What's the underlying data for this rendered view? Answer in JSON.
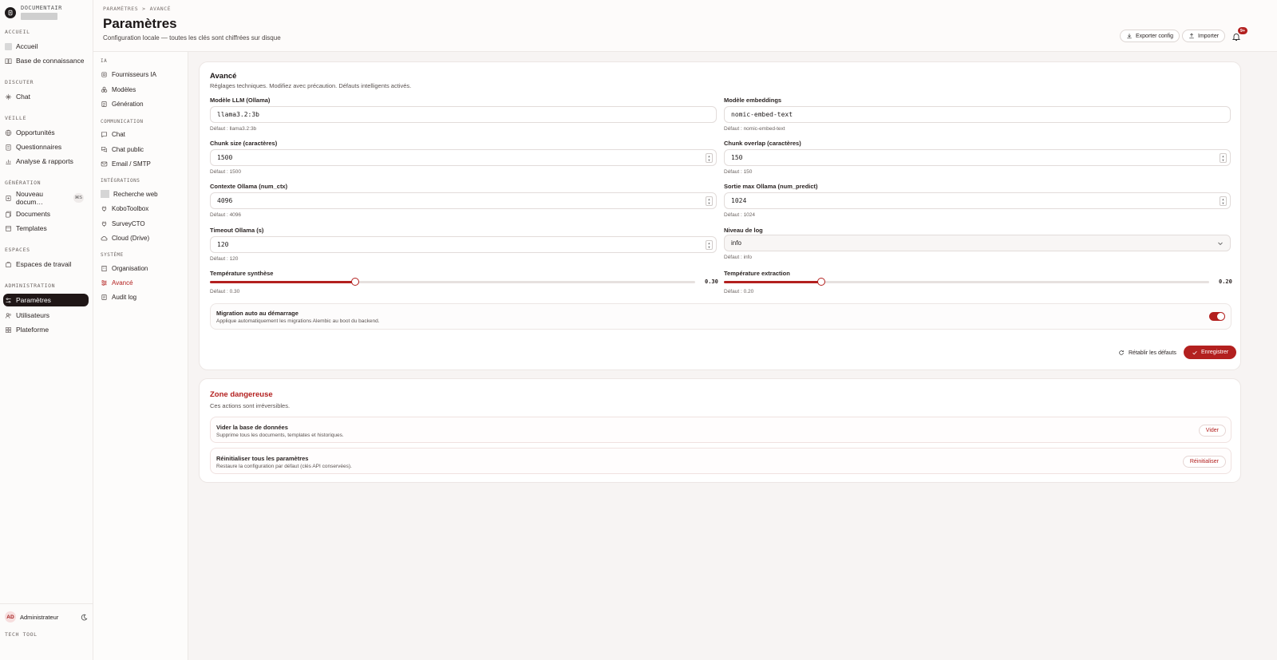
{
  "brand": {
    "name": "DOCUMENTAIR"
  },
  "sidebar": {
    "sections": [
      {
        "label": "ACCUEIL",
        "items": [
          "Accueil",
          "Base de connaissance"
        ]
      },
      {
        "label": "DISCUTER",
        "items": [
          "Chat"
        ]
      },
      {
        "label": "VEILLE",
        "items": [
          "Opportunités",
          "Questionnaires",
          "Analyse & rapports"
        ]
      },
      {
        "label": "GÉNÉRATION",
        "items": [
          "Nouveau docum…",
          "Documents",
          "Templates"
        ]
      },
      {
        "label": "ESPACES",
        "items": [
          "Espaces de travail"
        ]
      },
      {
        "label": "ADMINISTRATION",
        "items": [
          "Paramètres",
          "Utilisateurs",
          "Plateforme"
        ]
      }
    ],
    "shortcut": "⌘S",
    "active": "Paramètres",
    "user": {
      "initials": "AD",
      "name": "Administrateur"
    },
    "footer": "TECH TOOL"
  },
  "header": {
    "breadcrumb": [
      "PARAMÈTRES",
      ">",
      "AVANCÉ"
    ],
    "title": "Paramètres",
    "subtitle": "Configuration locale — toutes les clés sont chiffrées sur disque",
    "export_label": "Exporter config",
    "import_label": "Importer",
    "notif_count": "9+"
  },
  "subnav": {
    "sections": [
      {
        "label": "IA",
        "items": [
          "Fournisseurs IA",
          "Modèles",
          "Génération"
        ]
      },
      {
        "label": "COMMUNICATION",
        "items": [
          "Chat",
          "Chat public",
          "Email / SMTP"
        ]
      },
      {
        "label": "INTÉGRATIONS",
        "items": [
          "Recherche web",
          "KoboToolbox",
          "SurveyCTO",
          "Cloud (Drive)"
        ]
      },
      {
        "label": "SYSTÈME",
        "items": [
          "Organisation",
          "Avancé",
          "Audit log"
        ]
      }
    ],
    "active": "Avancé"
  },
  "advanced": {
    "title": "Avancé",
    "description": "Réglages techniques. Modifiez avec précaution. Défauts intelligents activés.",
    "fields": {
      "llm_model": {
        "label": "Modèle LLM (Ollama)",
        "value": "llama3.2:3b",
        "hint": "Défaut : llama3.2:3b"
      },
      "embed_model": {
        "label": "Modèle embeddings",
        "value": "nomic-embed-text",
        "hint": "Défaut : nomic-embed-text"
      },
      "chunk_size": {
        "label": "Chunk size (caractères)",
        "value": "1500",
        "hint": "Défaut : 1500"
      },
      "chunk_overlap": {
        "label": "Chunk overlap (caractères)",
        "value": "150",
        "hint": "Défaut : 150"
      },
      "num_ctx": {
        "label": "Contexte Ollama (num_ctx)",
        "value": "4096",
        "hint": "Défaut : 4096"
      },
      "num_predict": {
        "label": "Sortie max Ollama (num_predict)",
        "value": "1024",
        "hint": "Défaut : 1024"
      },
      "timeout": {
        "label": "Timeout Ollama (s)",
        "value": "120",
        "hint": "Défaut : 120"
      },
      "log_level": {
        "label": "Niveau de log",
        "value": "info",
        "hint": "Défaut : info"
      },
      "temp_synthesis": {
        "label": "Température synthèse",
        "value": 0.3,
        "display": "0.30",
        "max": 1,
        "hint": "Défaut : 0.30"
      },
      "temp_extraction": {
        "label": "Température extraction",
        "value": 0.2,
        "display": "0.20",
        "max": 1,
        "hint": "Défaut : 0.20"
      }
    },
    "migration": {
      "title": "Migration auto au démarrage",
      "description": "Applique automatiquement les migrations Alembic au boot du backend.",
      "enabled": true
    },
    "reset_label": "Rétablir les défauts",
    "save_label": "Enregistrer"
  },
  "danger": {
    "title": "Zone dangereuse",
    "description": "Ces actions sont irréversibles.",
    "rows": [
      {
        "title": "Vider la base de données",
        "description": "Supprime tous les documents, templates et historiques.",
        "button": "Vider"
      },
      {
        "title": "Réinitialiser tous les paramètres",
        "description": "Restaure la configuration par défaut (clés API conservées).",
        "button": "Réinitialiser"
      }
    ]
  },
  "colors": {
    "accent": "#b3201f",
    "sidebar_active": "#1f1616"
  }
}
